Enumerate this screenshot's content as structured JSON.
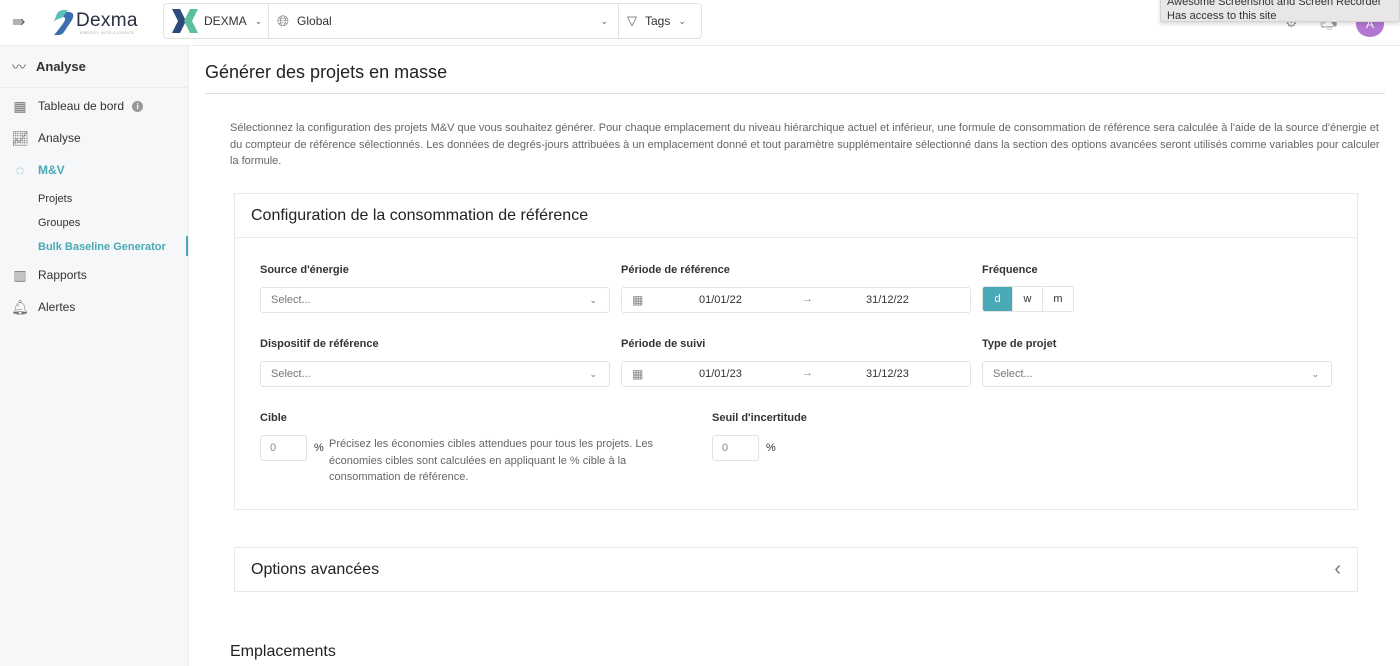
{
  "topbar": {
    "brand": "Dexma",
    "brand_sub": "ENERGY INTELLIGENCE",
    "org": "DEXMA",
    "location": "Global",
    "tags": "Tags",
    "avatar_initial": "A",
    "tooltip": {
      "line1": "Awesome Screenshot and Screen Recorder",
      "line2": "Has access to this site"
    }
  },
  "sidebar": {
    "section": "Analyse",
    "items": [
      {
        "label": "Tableau de bord",
        "icon": "dashboard-icon"
      },
      {
        "label": "Analyse",
        "icon": "chart-icon"
      },
      {
        "label": "M&V",
        "icon": "check-circle-icon"
      },
      {
        "label": "Rapports",
        "icon": "report-icon"
      },
      {
        "label": "Alertes",
        "icon": "bell-icon"
      }
    ],
    "subitems": [
      "Projets",
      "Groupes",
      "Bulk Baseline Generator"
    ]
  },
  "main": {
    "title": "Générer des projets en masse",
    "description": "Sélectionnez la configuration des projets M&V que vous souhaitez générer. Pour chaque emplacement du niveau hiérarchique actuel et inférieur, une formule de consommation de référence sera calculée à l'aide de la source d'énergie et du compteur de référence sélectionnés. Les données de degrés-jours attribuées à un emplacement donné et tout paramètre supplémentaire sélectionné dans la section des options avancées seront utilisés comme variables pour calculer la formule.",
    "config": {
      "title": "Configuration de la consommation de référence",
      "energy_source": {
        "label": "Source d'énergie",
        "placeholder": "Select..."
      },
      "reference_period": {
        "label": "Période de référence",
        "start": "01/01/22",
        "end": "31/12/22"
      },
      "frequency": {
        "label": "Fréquence",
        "options": [
          "d",
          "w",
          "m"
        ],
        "selected": "d"
      },
      "reference_device": {
        "label": "Dispositif de référence",
        "placeholder": "Select..."
      },
      "tracking_period": {
        "label": "Période de suivi",
        "start": "01/01/23",
        "end": "31/12/23"
      },
      "project_type": {
        "label": "Type de projet",
        "placeholder": "Select..."
      },
      "target": {
        "label": "Cible",
        "value": "0",
        "unit": "%",
        "hint": "Précisez les économies cibles attendues pour tous les projets. Les économies cibles sont calculées en appliquant le % cible à la consommation de référence."
      },
      "uncertainty": {
        "label": "Seuil d'incertitude",
        "value": "0",
        "unit": "%"
      }
    },
    "advanced_options": "Options avancées",
    "locations_title": "Emplacements"
  },
  "colors": {
    "accent": "#4aa9b6",
    "avatar": "#b377d1"
  }
}
